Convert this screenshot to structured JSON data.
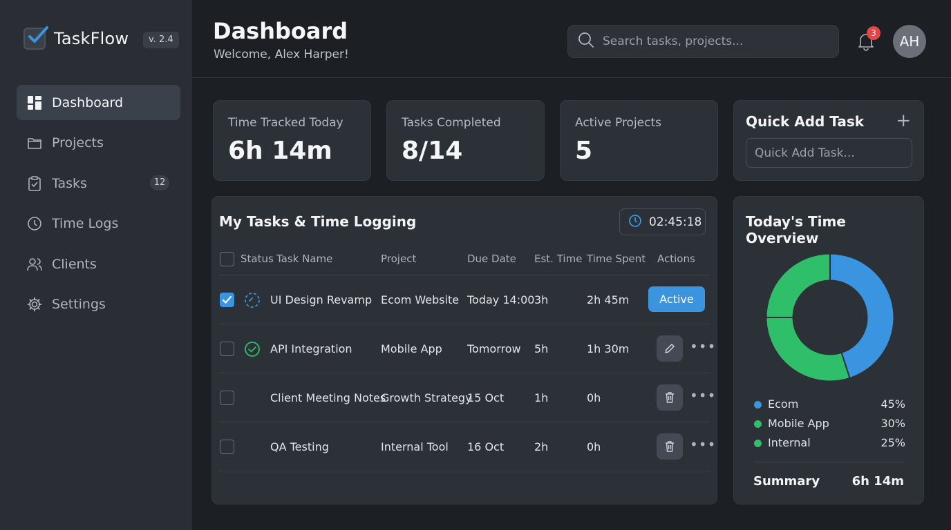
{
  "brand": {
    "name": "TaskFlow",
    "version": "v. 2.4"
  },
  "nav": {
    "items": [
      {
        "label": "Dashboard",
        "icon": "dashboard-icon",
        "active": true
      },
      {
        "label": "Projects",
        "icon": "folder-icon"
      },
      {
        "label": "Tasks",
        "icon": "clipboard-icon",
        "badge": "12"
      },
      {
        "label": "Time Logs",
        "icon": "clock-icon"
      },
      {
        "label": "Clients",
        "icon": "users-icon"
      },
      {
        "label": "Settings",
        "icon": "gear-icon"
      }
    ]
  },
  "header": {
    "title": "Dashboard",
    "welcome": "Welcome, Alex Harper!",
    "search_placeholder": "Search tasks, projects...",
    "notifications": "3",
    "avatar_initials": "AH"
  },
  "stats": [
    {
      "label": "Time Tracked Today",
      "value": "6h 14m"
    },
    {
      "label": "Tasks Completed",
      "value": "8/14"
    },
    {
      "label": "Active Projects",
      "value": "5"
    }
  ],
  "quick_add": {
    "title": "Quick Add Task",
    "plus": "+",
    "placeholder": "Quick Add Task..."
  },
  "tasks": {
    "title": "My Tasks & Time Logging",
    "timer": "02:45:18",
    "columns": [
      "Status",
      "Task Name",
      "Project",
      "Due Date",
      "Est. Time",
      "Time Spent",
      "Actions"
    ],
    "rows": [
      {
        "checked": true,
        "status": "in-progress",
        "name": "UI Design Revamp",
        "project": "Ecom Website",
        "due": "Today 14:00",
        "est": "3h",
        "spent": "2h 45m",
        "action": "Active"
      },
      {
        "checked": false,
        "status": "done",
        "name": "API Integration",
        "project": "Mobile App",
        "due": "Tomorrow",
        "est": "5h",
        "spent": "1h 30m",
        "action": "edit"
      },
      {
        "checked": false,
        "status": "none",
        "name": "Client Meeting Notes",
        "project": "Growth Strategy",
        "due": "15 Oct",
        "est": "1h",
        "spent": "0h",
        "action": "delete"
      },
      {
        "checked": false,
        "status": "none",
        "name": "QA Testing",
        "project": "Internal Tool",
        "due": "16 Oct",
        "est": "2h",
        "spent": "0h",
        "action": "delete"
      }
    ]
  },
  "time_overview": {
    "title": "Today's Time Overview",
    "segments": [
      {
        "name": "Ecom",
        "pct": "45%",
        "value": 45,
        "color": "#3b94e0"
      },
      {
        "name": "Mobile App",
        "pct": "30%",
        "value": 30,
        "color": "#2fbf6b"
      },
      {
        "name": "Internal",
        "pct": "25%",
        "value": 25,
        "color": "#2fbf6b"
      }
    ],
    "summary_label": "Summary",
    "summary_value": "6h 14m"
  }
}
